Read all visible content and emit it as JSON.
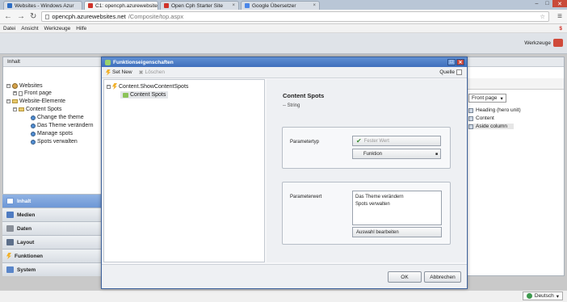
{
  "browser": {
    "tabs": [
      {
        "label": "Websites - Windows Azur",
        "icon": "azure-favicon",
        "color": "#2b6cc4"
      },
      {
        "label": "C1: opencph.azurewebsite",
        "icon": "c1-favicon",
        "color": "#d0332a"
      },
      {
        "label": "Open Cph Starter Site",
        "icon": "c1-favicon",
        "color": "#d0332a"
      },
      {
        "label": "Google Übersetzer",
        "icon": "google-translate-favicon",
        "color": "#4a86e8"
      }
    ],
    "url_host": "opencph.azurewebsites.net",
    "url_path": "/Composite/top.aspx"
  },
  "menu": [
    "Datei",
    "Ansicht",
    "Werkzeuge",
    "Hilfe"
  ],
  "appbar": {
    "tools_label": "Werkzeuge"
  },
  "left_panel": {
    "header": "Inhalt",
    "tree": [
      {
        "label": "Websites",
        "level": 0,
        "icon": "globe-icon"
      },
      {
        "label": "Front page",
        "level": 1,
        "icon": "page-icon"
      },
      {
        "label": "Website-Elemente",
        "level": 0,
        "icon": "folder-icon"
      },
      {
        "label": "Content Spots",
        "level": 1,
        "icon": "folder-icon"
      },
      {
        "label": "Change the theme",
        "level": 2,
        "icon": "gear-icon"
      },
      {
        "label": "Das Theme verändern",
        "level": 2,
        "icon": "gear-icon"
      },
      {
        "label": "Manage spots",
        "level": 2,
        "icon": "gear-icon"
      },
      {
        "label": "Spots verwalten",
        "level": 2,
        "icon": "gear-icon"
      }
    ],
    "sections": [
      {
        "label": "Inhalt",
        "color": "#6d97d6",
        "active": true
      },
      {
        "label": "Medien",
        "color": "#4f7cc2"
      },
      {
        "label": "Daten",
        "color": "#8a9099"
      },
      {
        "label": "Layout",
        "color": "#5d6f8a"
      },
      {
        "label": "Funktionen",
        "color": "#f2b12a"
      },
      {
        "label": "System",
        "color": "#5a86c9"
      }
    ]
  },
  "right_panel": {
    "selector": "Front page",
    "items": [
      {
        "label": "Heading (hero unit)",
        "selected": false
      },
      {
        "label": "Content",
        "selected": false
      },
      {
        "label": "Aside column",
        "selected": true
      }
    ]
  },
  "dialog": {
    "title": "Funktionseigenschaften",
    "toolbar": {
      "set_new": "Set New",
      "delete": "Löschen",
      "source": "Quelle"
    },
    "tree": [
      {
        "label": "Content.ShowContentSpots",
        "level": 0
      },
      {
        "label": "Content Spots",
        "level": 1
      }
    ],
    "detail": {
      "title": "Content Spots",
      "type": "-- String",
      "param_type_label": "Parametertyp",
      "fixed_value_button": "Fester Wert",
      "function_button": "Funktion",
      "param_value_label": "Parameterwert",
      "values": [
        "Das Theme verändern",
        "Spots verwalten"
      ],
      "edit_selection_button": "Auswahl bearbeiten"
    },
    "ok": "OK",
    "cancel": "Abbrechen"
  },
  "status": {
    "language": "Deutsch"
  }
}
